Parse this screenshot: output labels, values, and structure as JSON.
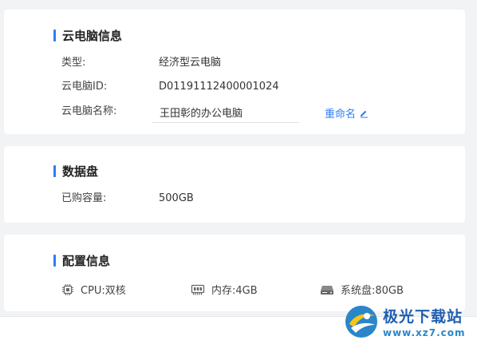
{
  "info": {
    "title": "云电脑信息",
    "type_label": "类型:",
    "type_value": "经济型云电脑",
    "id_label": "云电脑ID:",
    "id_value": "D01191112400001024",
    "name_label": "云电脑名称:",
    "name_value": "王田彰的办公电脑",
    "rename_label": "重命名"
  },
  "disk": {
    "title": "数据盘",
    "capacity_label": "已购容量:",
    "capacity_value": "500GB"
  },
  "config": {
    "title": "配置信息",
    "items": [
      {
        "icon": "cpu-icon",
        "text": "CPU:双核"
      },
      {
        "icon": "memory-icon",
        "text": "内存:4GB"
      },
      {
        "icon": "disk-icon",
        "text": "系统盘:80GB"
      }
    ]
  },
  "watermark": {
    "title": "极光下载站",
    "url": "www.xz7.com"
  },
  "colors": {
    "accent": "#2f7cf6",
    "background": "#f2f3f5",
    "card": "#ffffff"
  }
}
